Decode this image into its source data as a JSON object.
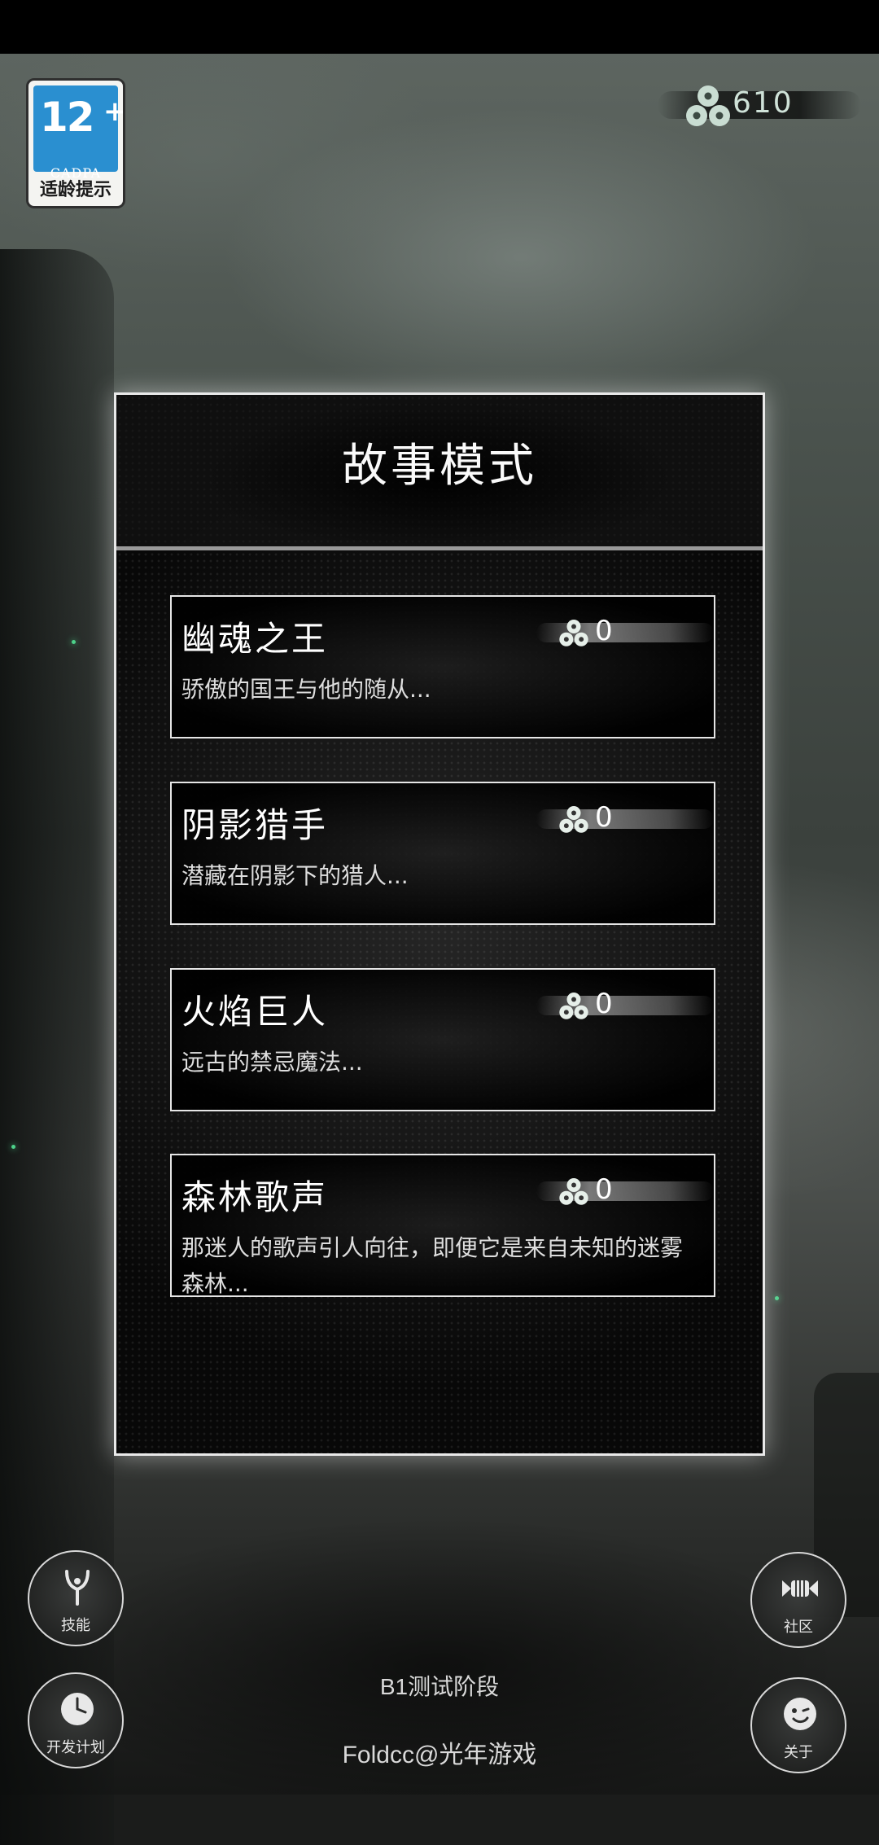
{
  "age_badge": {
    "rating": "12",
    "plus": "+",
    "org": "CADPA",
    "tip": "适龄提示"
  },
  "currency": {
    "icon": "triple-orb-icon",
    "value": "610"
  },
  "panel": {
    "title": "故事模式",
    "stories": [
      {
        "title": "幽魂之王",
        "desc": "骄傲的国王与他的随从...",
        "reward": "0"
      },
      {
        "title": "阴影猎手",
        "desc": "潜藏在阴影下的猎人...",
        "reward": "0"
      },
      {
        "title": "火焰巨人",
        "desc": "远古的禁忌魔法...",
        "reward": "0"
      },
      {
        "title": "森林歌声",
        "desc": "那迷人的歌声引人向往，即便它是来自未知的迷雾森林...",
        "reward": "0"
      }
    ]
  },
  "buttons": {
    "skills": {
      "label": "技能",
      "icon": "slingshot-icon"
    },
    "community": {
      "label": "社区",
      "icon": "candy-icon"
    },
    "dev_plan": {
      "label": "开发计划",
      "icon": "clock-icon"
    },
    "about": {
      "label": "关于",
      "icon": "wink-face-icon"
    }
  },
  "footer": {
    "stage": "B1测试阶段",
    "credit": "Foldcc@光年游戏"
  },
  "colors": {
    "accent_green": "#4dd28a",
    "badge_blue": "#2a8fd0",
    "panel_border": "#e9e9e9"
  }
}
